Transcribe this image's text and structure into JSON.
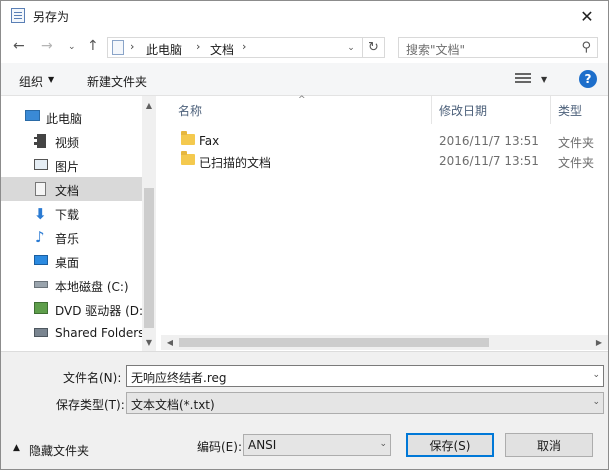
{
  "window": {
    "title": "另存为",
    "close_glyph": "✕"
  },
  "nav": {
    "back_glyph": "←",
    "forward_glyph": "→",
    "recent_glyph": "⌄",
    "up_glyph": "↑",
    "breadcrumb": [
      "此电脑",
      "文档"
    ],
    "separator_glyph": "›",
    "dropdown_glyph": "⌄",
    "refresh_glyph": "↻",
    "search_placeholder": "搜索\"文档\"",
    "search_glyph": "⚲"
  },
  "toolbar": {
    "organize": "组织",
    "organize_arrow": "▼",
    "new_folder": "新建文件夹",
    "view_arrow": "▼",
    "help": "?"
  },
  "sidebar": {
    "items": [
      {
        "label": "此电脑",
        "icon": "computer-icon"
      },
      {
        "label": "视频",
        "icon": "video-icon"
      },
      {
        "label": "图片",
        "icon": "pictures-icon"
      },
      {
        "label": "文档",
        "icon": "documents-icon",
        "selected": true
      },
      {
        "label": "下载",
        "icon": "download-icon"
      },
      {
        "label": "音乐",
        "icon": "music-icon"
      },
      {
        "label": "桌面",
        "icon": "desktop-icon"
      },
      {
        "label": "本地磁盘 (C:)",
        "icon": "drive-icon"
      },
      {
        "label": "DVD 驱动器 (D:",
        "icon": "dvd-icon"
      },
      {
        "label": "Shared Folders",
        "icon": "network-icon"
      }
    ],
    "scroll_up": "▲",
    "scroll_down": "▼"
  },
  "columns": {
    "name": "名称",
    "modified": "修改日期",
    "type": "类型",
    "sort_glyph": "^"
  },
  "files": [
    {
      "name": "Fax",
      "date": "2016/11/7 13:51",
      "type": "文件夹"
    },
    {
      "name": "已扫描的文档",
      "date": "2016/11/7 13:51",
      "type": "文件夹"
    }
  ],
  "hscroll": {
    "left": "◀",
    "right": "▶"
  },
  "form": {
    "filename_label": "文件名(N):",
    "filename_value": "无响应终结者.reg",
    "savetype_label": "保存类型(T):",
    "savetype_value": "文本文档(*.txt)",
    "dropdown_glyph": "⌄",
    "encoding_label": "编码(E):",
    "encoding_value": "ANSI",
    "hide_folders": "隐藏文件夹",
    "hide_caret": "▲",
    "save_button": "保存(S)",
    "cancel_button": "取消"
  },
  "colors": {
    "accent": "#0078d7",
    "help": "#1e6fcb",
    "folder": "#f4c94e",
    "selected": "#d9d9d9"
  }
}
